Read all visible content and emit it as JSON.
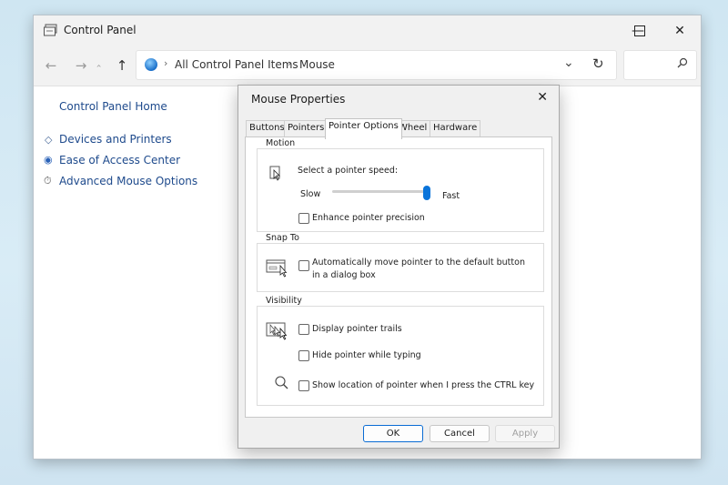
{
  "window": {
    "title": "Control Panel",
    "icon": "control-panel-icon",
    "controls": {
      "minimize": "—",
      "maximize": "☐",
      "close": "✕"
    }
  },
  "address": {
    "back_icon": "←",
    "forward_icon": "→",
    "history_icon": "⌄",
    "up_icon": "↑",
    "crumbs": [
      "All Control Panel Items",
      "Mouse"
    ],
    "sep": "›",
    "dropdown_icon": "⌄",
    "refresh_icon": "↻",
    "search_icon": "⌕"
  },
  "sidebar": {
    "home": "Control Panel Home",
    "links": [
      {
        "label": "Devices and Printers",
        "icon": "◇"
      },
      {
        "label": "Ease of Access Center",
        "icon": "◉"
      },
      {
        "label": "Advanced Mouse Options",
        "icon": "⏱"
      }
    ]
  },
  "dialog": {
    "title": "Mouse Properties",
    "close": "✕",
    "tabs": [
      "Buttons",
      "Pointers",
      "Pointer Options",
      "Wheel",
      "Hardware"
    ],
    "active_tab": "Pointer Options",
    "motion": {
      "group": "Motion",
      "speed_label": "Select a pointer speed:",
      "slow": "Slow",
      "fast": "Fast",
      "speed_level": 1.0,
      "precision": "Enhance pointer precision",
      "precision_checked": false
    },
    "snap": {
      "group": "Snap To",
      "label_line1": "Automatically move pointer to the default button",
      "label_line2": "in a dialog box",
      "checked": false
    },
    "visibility": {
      "group": "Visibility",
      "trails": "Display pointer trails",
      "hide": "Hide pointer while typing",
      "show_location": "Show location of pointer when I press the CTRL key",
      "trails_checked": false,
      "hide_checked": false,
      "show_checked": false
    },
    "buttons": {
      "ok": "OK",
      "cancel": "Cancel",
      "apply": "Apply"
    }
  },
  "colors": {
    "accent": "#0a74da",
    "link": "#1e4a8c"
  }
}
